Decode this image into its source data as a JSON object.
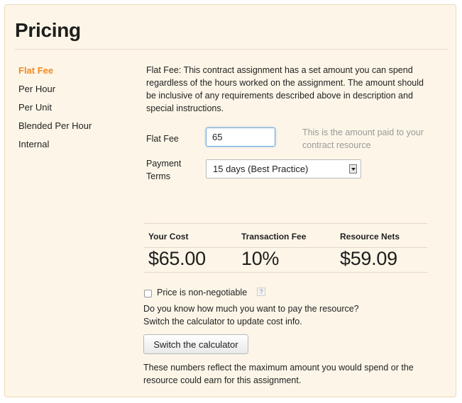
{
  "header": {
    "title": "Pricing"
  },
  "nav": {
    "items": [
      {
        "label": "Flat Fee"
      },
      {
        "label": "Per Hour"
      },
      {
        "label": "Per Unit"
      },
      {
        "label": "Blended Per Hour"
      },
      {
        "label": "Internal"
      }
    ],
    "active_index": 0
  },
  "description": "Flat Fee: This contract assignment has a set amount you can spend regardless of the hours worked on the assignment. The amount should be inclusive of any requirements described above in description and special instructions.",
  "flat_fee": {
    "label": "Flat Fee",
    "value": "65",
    "hint": "This is the amount paid to your contract resource"
  },
  "payment_terms": {
    "label": "Payment Terms",
    "selected": "15 days (Best Practice)"
  },
  "cost_table": {
    "headers": [
      "Your Cost",
      "Transaction Fee",
      "Resource Nets"
    ],
    "values": [
      "$65.00",
      "10%",
      "$59.09"
    ]
  },
  "non_negotiable": {
    "label": "Price is non-negotiable",
    "checked": false,
    "help": "?"
  },
  "calculator": {
    "prompt_line1": "Do you know how much you want to pay the resource?",
    "prompt_line2": "Switch the calculator to update cost info.",
    "button_label": "Switch the calculator"
  },
  "footnote": "These numbers reflect the maximum amount you would spend or the resource could earn for this assignment.",
  "colors": {
    "panel_bg": "#fdf6e8",
    "accent_orange": "#f08a24",
    "input_focus_blue": "#6fa7de"
  }
}
